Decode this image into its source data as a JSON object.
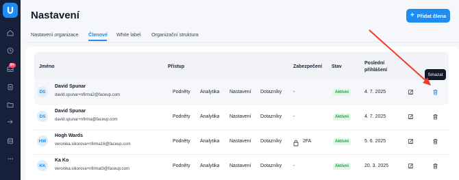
{
  "sidebar": {
    "notification_badge": "9+",
    "icons": [
      "home-icon",
      "activity-icon",
      "inbox-icon",
      "clipboard-icon",
      "folder-icon",
      "share-icon",
      "database-icon",
      "more-icon"
    ]
  },
  "page": {
    "title": "Nastavení",
    "add_member_label": "Přidat člena"
  },
  "tabs": [
    {
      "label": "Nastavení organizace",
      "active": false
    },
    {
      "label": "Členové",
      "active": true
    },
    {
      "label": "White label",
      "active": false
    },
    {
      "label": "Organizační struktura",
      "active": false
    }
  ],
  "table": {
    "headers": {
      "name": "Jméno",
      "access": "Přístup",
      "security": "Zabezpečení",
      "status": "Stav",
      "last_login_line1": "Poslední",
      "last_login_line2": "přihlášení"
    },
    "rows": [
      {
        "initials": "DS",
        "name": "David Spunar",
        "email": "david.spunar+nfirma2@faceup.com",
        "permissions": [
          "Podněty",
          "Analytika",
          "Nastavení",
          "Dotazníky"
        ],
        "security": "-",
        "status": "Aktivní",
        "last_login": "4. 7. 2025"
      },
      {
        "initials": "DS",
        "name": "David Spunar",
        "email": "david.spunar+nfirma@faceup.com",
        "permissions": [
          "Podněty",
          "Analytika",
          "Nastavení",
          "Dotazníky"
        ],
        "security": "-",
        "status": "Aktivní",
        "last_login": "4. 7. 2025"
      },
      {
        "initials": "HW",
        "name": "Hogh Wards",
        "email": "veronika.sikorova+nfirma16@faceup.com",
        "permissions": [
          "Podněty",
          "Analytika",
          "Nastavení",
          "Dotazníky"
        ],
        "security": "2FA",
        "status": "Aktivní",
        "last_login": "5. 6. 2025"
      },
      {
        "initials": "KK",
        "name": "Ka Ko",
        "email": "veronika.sikorova+nfirmat3@faceup.com",
        "permissions": [
          "Podněty",
          "Analytika",
          "Nastavení",
          "Dotazníky"
        ],
        "security": "-",
        "status": "Aktivní",
        "last_login": "20. 3. 2025"
      }
    ]
  },
  "tooltip": {
    "delete": "Smazat"
  },
  "colors": {
    "accent": "#1e8cf0",
    "sidebar": "#17203a",
    "status_green": "#1e9d45",
    "annotation_arrow": "#f03a24"
  }
}
